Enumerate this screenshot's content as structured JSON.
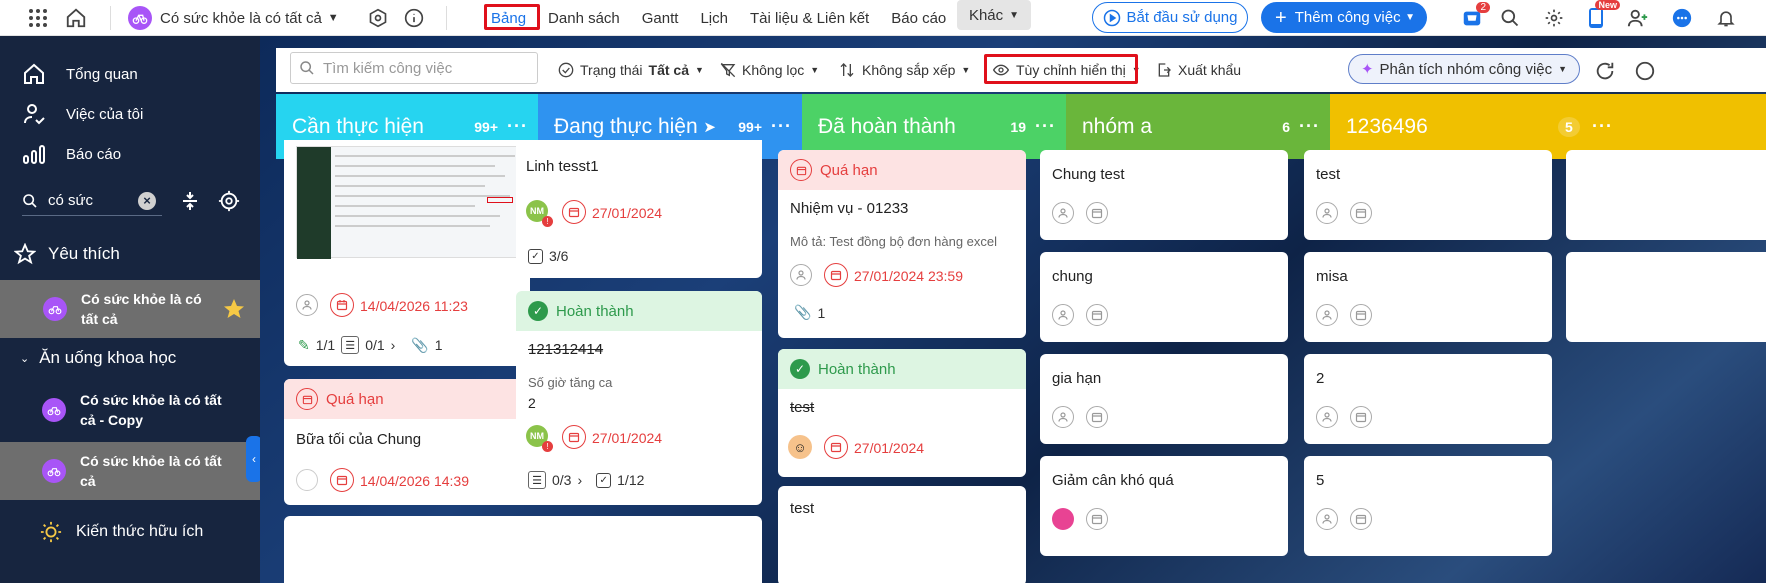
{
  "topbar": {
    "project_name": "Có sức khỏe là có tất cả",
    "tabs": [
      "Bảng",
      "Danh sách",
      "Gantt",
      "Lịch",
      "Tài liệu & Liên kết",
      "Báo cáo"
    ],
    "more_label": "Khác",
    "start_button": "Bắt đầu sử dụng",
    "add_task_button": "Thêm công việc",
    "cart_badge": "2",
    "new_badge": "New"
  },
  "sidebar": {
    "overview": "Tổng quan",
    "my_tasks": "Việc của tôi",
    "reports": "Báo cáo",
    "search_value": "có sức",
    "favorites": "Yêu thích",
    "fav_project": "Có sức khỏe là có tất cả",
    "group_name": "Ăn uống khoa học",
    "group_item_1": "Có sức khỏe là có tất cả - Copy",
    "group_item_2": "Có sức khỏe là có tất cả",
    "knowledge": "Kiến thức hữu ích"
  },
  "toolbar": {
    "search_placeholder": "Tìm kiếm công việc",
    "status_label": "Trạng thái",
    "status_value": "Tất cả",
    "filter_label": "Không lọc",
    "sort_label": "Không sắp xếp",
    "custom_view_label": "Tùy chỉnh hiển thị",
    "export_label": "Xuất khẩu",
    "analyze_label": "Phân tích nhóm công việc"
  },
  "columns": [
    {
      "title": "Cần thực hiện",
      "count": "99+",
      "color": "#26d4f0"
    },
    {
      "title": "Đang thực hiện",
      "count": "99+",
      "color": "#2f93f0"
    },
    {
      "title": "Đã hoàn thành",
      "count": "19",
      "color": "#4cd266"
    },
    {
      "title": "nhóm a",
      "count": "6",
      "color": "#6ab63b"
    },
    {
      "title": "1236496",
      "count": "5",
      "color": "#f0c000"
    }
  ],
  "cards": {
    "c1_date": "14/04/2026 11:23",
    "c1_sub": "1/1",
    "c1_tree": "0/1",
    "c1_attach": "1",
    "c2_band": "Quá hạn",
    "c2_title": "Bữa tối của Chung",
    "c2_date": "14/04/2026 14:39",
    "d1_title": "Linh tesst1",
    "d1_avatar": "NM",
    "d1_date": "27/01/2024",
    "d1_check": "3/6",
    "d2_band": "Hoàn thành",
    "d2_title": "121312414",
    "d2_field_label": "Số giờ tăng ca",
    "d2_field_value": "2",
    "d2_avatar": "NM",
    "d2_date": "27/01/2024",
    "d2_tree": "0/3",
    "d2_check": "1/12",
    "e1_band": "Quá hạn",
    "e1_title": "Nhiệm vụ - 01233",
    "e1_desc": "Mô tả: Test đồng bộ đơn hàng excel",
    "e1_date": "27/01/2024 23:59",
    "e1_attach": "1",
    "e2_band": "Hoàn thành",
    "e2_title": "test",
    "e2_date": "27/01/2024",
    "e3_title": "test",
    "f1": "Chung test",
    "f2": "chung",
    "f3": "gia hạn",
    "f4": "Giảm cân khó quá",
    "g1": "test",
    "g2": "misa",
    "g3": "2",
    "g4": "5"
  }
}
